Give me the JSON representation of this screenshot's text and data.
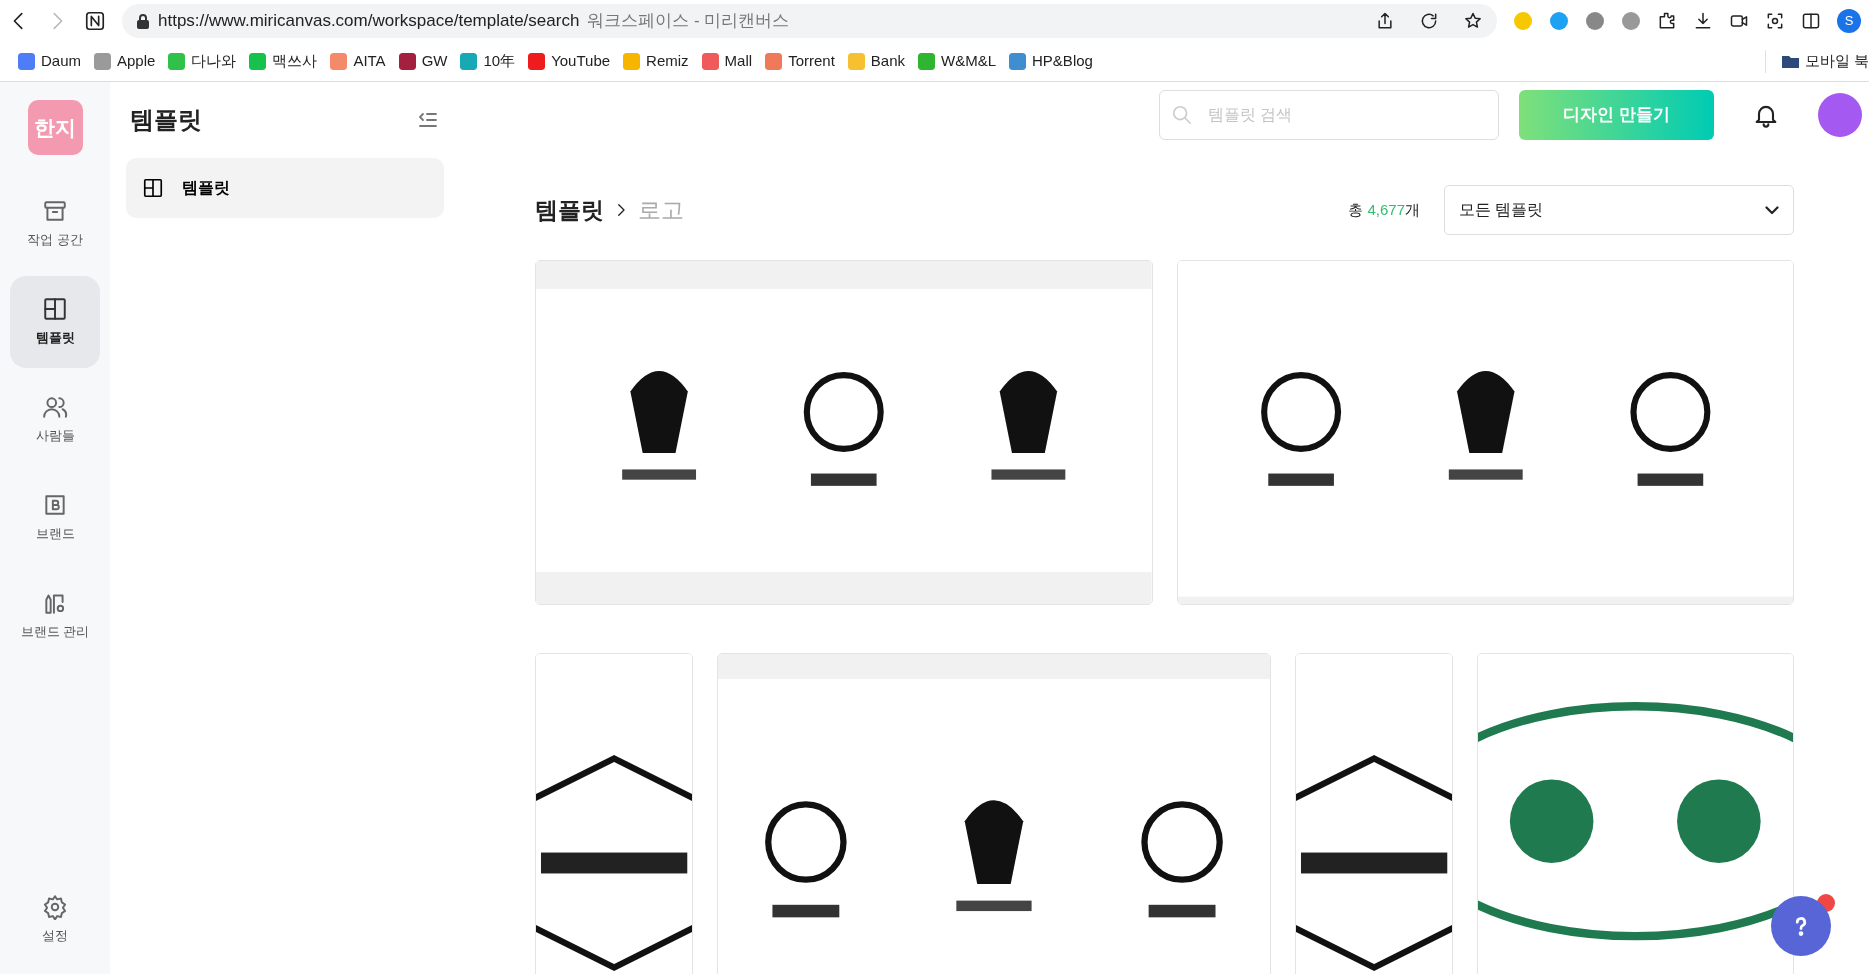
{
  "browser": {
    "url": "https://www.miricanvas.com/workspace/template/search",
    "page_title": "워크스페이스 - 미리캔버스",
    "profile_initial": "S"
  },
  "bookmarks": [
    {
      "label": "Daum",
      "color": "#4f7cf7"
    },
    {
      "label": "Apple",
      "color": "#9a9a9a"
    },
    {
      "label": "다나와",
      "color": "#2fc14a"
    },
    {
      "label": "맥쓰사",
      "color": "#17c24c"
    },
    {
      "label": "AITA",
      "color": "#f58a6a"
    },
    {
      "label": "GW",
      "color": "#a3213f"
    },
    {
      "label": "10年",
      "color": "#17a9b4"
    },
    {
      "label": "YouTube",
      "color": "#ee1c1c"
    },
    {
      "label": "Remiz",
      "color": "#f7b500"
    },
    {
      "label": "Mall",
      "color": "#ef5a5a"
    },
    {
      "label": "Torrent",
      "color": "#ef7a5a"
    },
    {
      "label": "Bank",
      "color": "#f7c032"
    },
    {
      "label": "W&M&L",
      "color": "#2fb52f"
    },
    {
      "label": "HP&Blog",
      "color": "#3f8fd0"
    }
  ],
  "mobile_bookmarks": "모바일 북",
  "rail": {
    "logo": "한지",
    "items": [
      {
        "label": "작업 공간",
        "selected": false
      },
      {
        "label": "템플릿",
        "selected": true
      },
      {
        "label": "사람들",
        "selected": false
      },
      {
        "label": "브랜드",
        "selected": false
      },
      {
        "label": "브랜드 관리",
        "selected": false
      }
    ],
    "settings": "설정"
  },
  "panel": {
    "title": "템플릿",
    "items": [
      {
        "label": "템플릿",
        "selected": true
      }
    ]
  },
  "header": {
    "search_placeholder": "템플릿 검색",
    "create_button": "디자인 만들기"
  },
  "breadcrumb": [
    {
      "label": "템플릿",
      "current": false
    },
    {
      "label": "로고",
      "current": true
    }
  ],
  "count": {
    "prefix": "총 ",
    "number": "4,677",
    "suffix": "개"
  },
  "filter": {
    "value": "모든 템플릿"
  }
}
